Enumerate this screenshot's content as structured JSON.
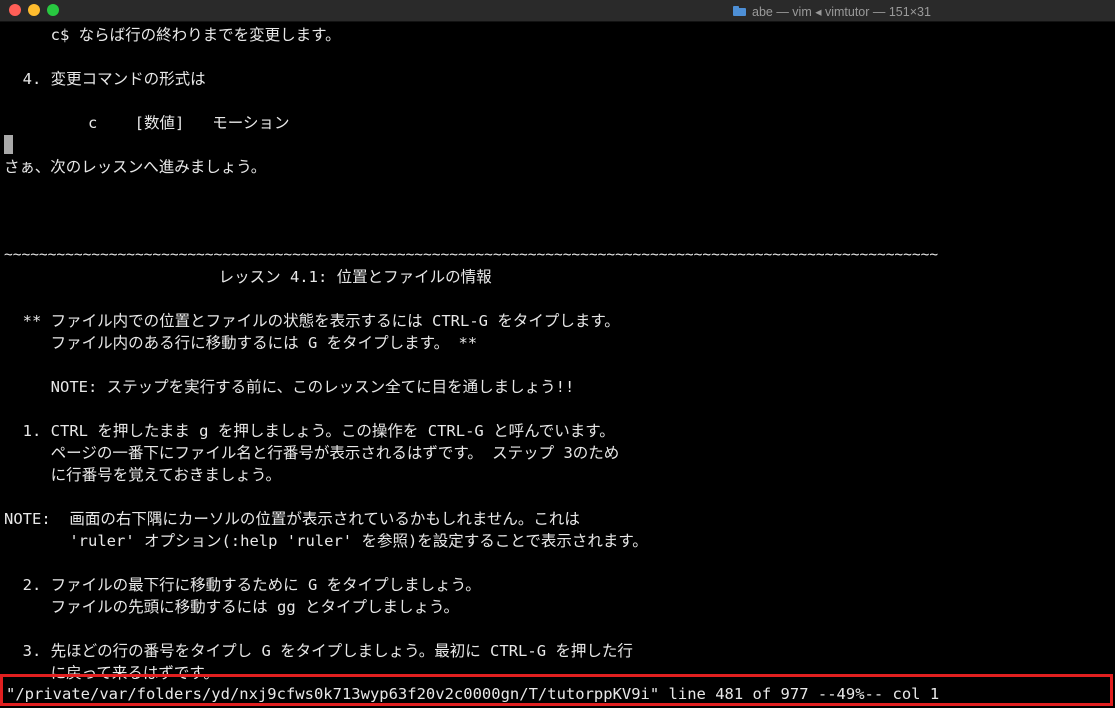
{
  "window": {
    "title": "abe — vim ◂ vimtutor — 151×31"
  },
  "colors": {
    "background": "#000000",
    "text": "#e8e8e8",
    "highlight_border": "#e01f1f",
    "close": "#ff5f57",
    "minimize": "#febc2e",
    "maximize": "#28c840"
  },
  "editor": {
    "lines": [
      "     c$ ならば行の終わりまでを変更します。",
      "",
      "  4. 変更コマンドの形式は",
      "",
      "         c    [数値]   モーション",
      "",
      "さぁ、次のレッスンへ進みましょう。",
      "",
      "",
      "",
      "~~~~~~~~~~~~~~~~~~~~~~~~~~~~~~~~~~~~~~~~~~~~~~~~~~~~~~~~~~~~~~~~~~~~~~~~~~~~~~~~~~~~~~~~~~~~~~~~~~~~~~~~~~~",
      "                       レッスン 4.1: 位置とファイルの情報",
      "",
      "  ** ファイル内での位置とファイルの状態を表示するには CTRL-G をタイプします。",
      "     ファイル内のある行に移動するには G をタイプします。 **",
      "",
      "     NOTE: ステップを実行する前に、このレッスン全てに目を通しましょう!!",
      "",
      "  1. CTRL を押したまま g を押しましょう。この操作を CTRL-G と呼んでいます。",
      "     ページの一番下にファイル名と行番号が表示されるはずです。 ステップ 3のため",
      "     に行番号を覚えておきましょう。",
      "",
      "NOTE:  画面の右下隅にカーソルの位置が表示されているかもしれません。これは",
      "       'ruler' オプション(:help 'ruler' を参照)を設定することで表示されます。",
      "",
      "  2. ファイルの最下行に移動するために G をタイプしましょう。",
      "     ファイルの先頭に移動するには gg とタイプしましょう。",
      "",
      "  3. 先ほどの行の番号をタイプし G をタイプしましょう。最初に CTRL-G を押した行",
      "     に戻って来るはずです。"
    ],
    "status_line": "\"/private/var/folders/yd/nxj9cfws0k713wyp63f20v2c0000gn/T/tutorppKV9i\" line 481 of 977 --49%-- col 1"
  }
}
